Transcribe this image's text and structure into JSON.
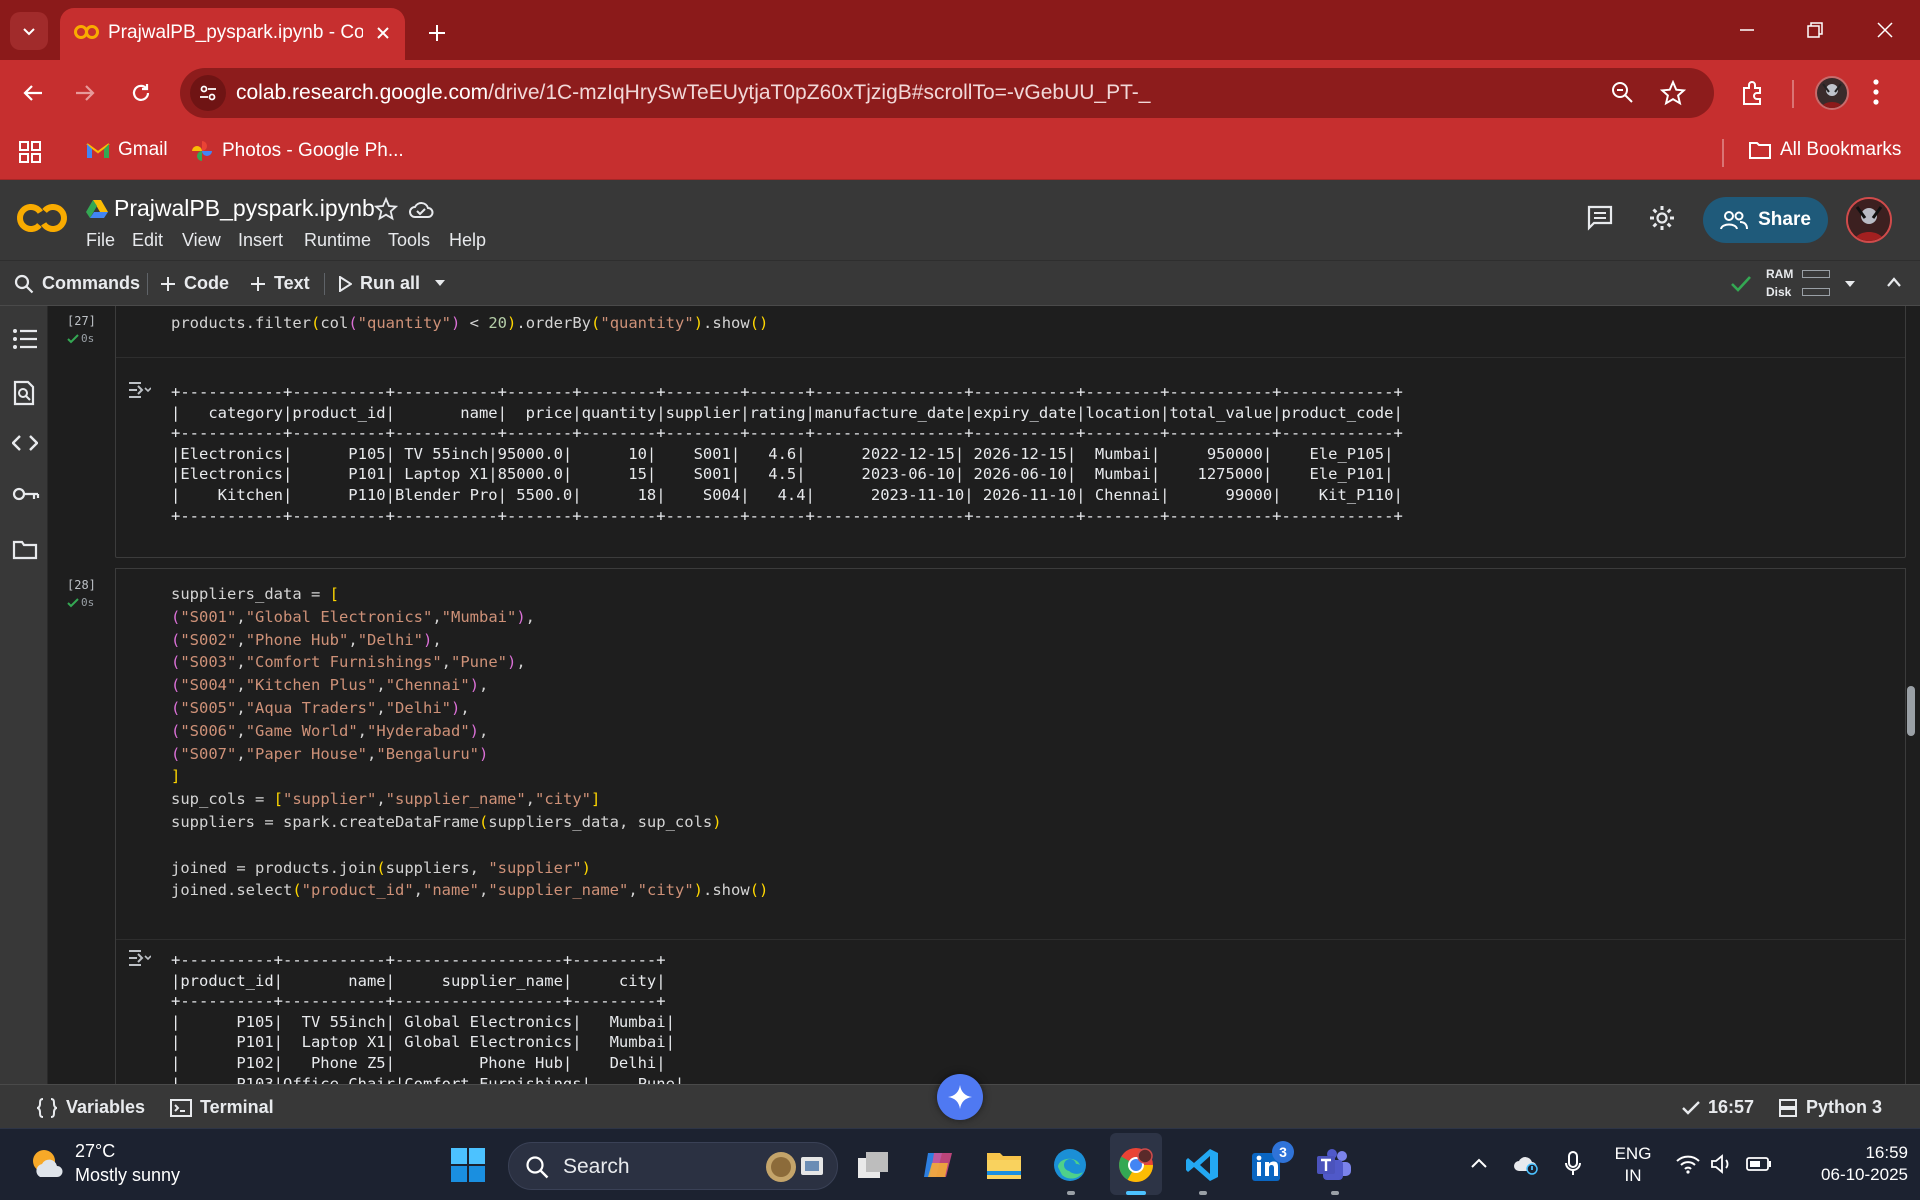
{
  "browser": {
    "tab_title": "PrajwalPB_pyspark.ipynb - Colab",
    "url_host": "colab.research.google.com",
    "url_path": "/drive/1C-mzIqHrySwTeEUytjaT0pZ60xTjzigB#scrollTo=-vGebUU_PT-_",
    "bookmarks": [
      {
        "label": "Gmail"
      },
      {
        "label": "Photos - Google Ph..."
      }
    ],
    "all_bookmarks": "All Bookmarks",
    "accent": "#c62f2f"
  },
  "colab": {
    "notebook_title": "PrajwalPB_pyspark.ipynb",
    "menu": [
      "File",
      "Edit",
      "View",
      "Insert",
      "Runtime",
      "Tools",
      "Help"
    ],
    "share_label": "Share",
    "toolbar": {
      "commands": "Commands",
      "code": "Code",
      "text": "Text",
      "run_all": "Run all",
      "ram": "RAM",
      "disk": "Disk"
    }
  },
  "cells": [
    {
      "exec_count": "[27]",
      "time": "0s",
      "code_line": "products.filter(col(\"quantity\") < 20).orderBy(\"quantity\").show()",
      "output": "+-----------+----------+-----------+-------+--------+--------+------+----------------+-----------+--------+-----------+------------+\n|   category|product_id|       name|  price|quantity|supplier|rating|manufacture_date|expiry_date|location|total_value|product_code|\n+-----------+----------+-----------+-------+--------+--------+------+----------------+-----------+--------+-----------+------------+\n|Electronics|      P105| TV 55inch|95000.0|      10|    S001|   4.6|      2022-12-15| 2026-12-15|  Mumbai|     950000|    Ele_P105|\n|Electronics|      P101| Laptop X1|85000.0|      15|    S001|   4.5|      2023-06-10| 2026-06-10|  Mumbai|    1275000|    Ele_P101|\n|    Kitchen|      P110|Blender Pro| 5500.0|      18|    S004|   4.4|      2023-11-10| 2026-11-10| Chennai|      99000|    Kit_P110|\n+-----------+----------+-----------+-------+--------+--------+------+----------------+-----------+--------+-----------+------------+"
    },
    {
      "exec_count": "[28]",
      "time": "0s",
      "output": "+----------+-----------+------------------+---------+\n|product_id|       name|     supplier_name|     city|\n+----------+-----------+------------------+---------+\n|      P105|  TV 55inch| Global Electronics|   Mumbai|\n|      P101|  Laptop X1| Global Electronics|   Mumbai|\n|      P102|   Phone Z5|         Phone Hub|    Delhi|\n|      P103|Office Chair|Comfort Furnishings|     Pune|"
    }
  ],
  "statusbar": {
    "variables": "Variables",
    "terminal": "Terminal",
    "time": "16:57",
    "kernel": "Python 3"
  },
  "taskbar": {
    "temp": "27°C",
    "weather": "Mostly sunny",
    "search": "Search",
    "lang_top": "ENG",
    "lang_bottom": "IN",
    "clock_time": "16:59",
    "clock_date": "06-10-2025",
    "linkedin_badge": "3"
  }
}
